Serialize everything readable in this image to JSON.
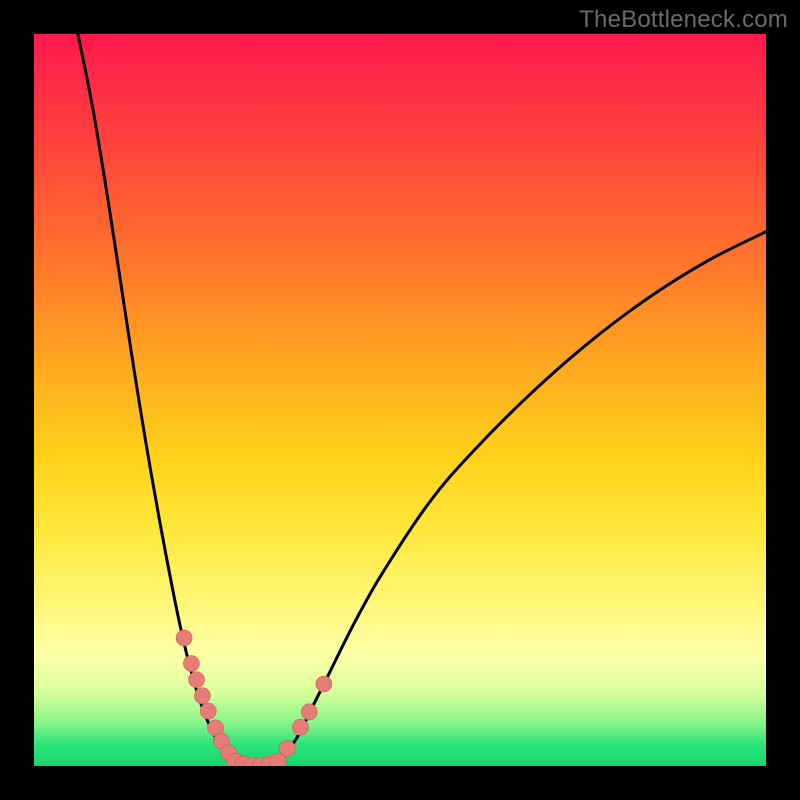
{
  "watermark": "TheBottleneck.com",
  "chart_data": {
    "type": "line",
    "title": "",
    "xlabel": "",
    "ylabel": "",
    "xlim": [
      0,
      100
    ],
    "ylim": [
      0,
      100
    ],
    "series": [
      {
        "name": "left-curve",
        "x": [
          6,
          8,
          10,
          12,
          14,
          16,
          18,
          20,
          22,
          24,
          26,
          27,
          28
        ],
        "values": [
          100,
          90,
          78,
          65,
          52,
          40,
          29,
          19,
          11,
          5.5,
          2,
          0.8,
          0
        ]
      },
      {
        "name": "right-curve",
        "x": [
          33,
          34,
          36,
          38,
          40,
          44,
          48,
          54,
          60,
          68,
          76,
          84,
          92,
          100
        ],
        "values": [
          0,
          1.2,
          4,
          8,
          12,
          20,
          27,
          36,
          43,
          51,
          58,
          64,
          69,
          73
        ]
      },
      {
        "name": "valley-floor",
        "x": [
          28,
          29,
          30,
          31,
          32,
          33
        ],
        "values": [
          0,
          0,
          0,
          0,
          0,
          0
        ]
      }
    ],
    "markers": {
      "left_arm": {
        "name": "left-markers",
        "x": [
          20.5,
          21.5,
          22.2,
          23.0,
          23.8,
          24.8,
          25.6,
          26.6
        ],
        "values": [
          17.5,
          14.0,
          11.8,
          9.6,
          7.5,
          5.2,
          3.4,
          1.8
        ]
      },
      "valley": {
        "name": "valley-markers",
        "x": [
          27.5,
          28.6,
          29.8,
          31.0,
          32.2,
          33.3
        ],
        "values": [
          0.6,
          0.2,
          0.0,
          0.0,
          0.2,
          0.6
        ]
      },
      "right_arm": {
        "name": "right-markers",
        "x": [
          34.6,
          36.4,
          37.6,
          39.6
        ],
        "values": [
          2.4,
          5.3,
          7.4,
          11.2
        ]
      }
    },
    "colors": {
      "curve": "#000000",
      "marker_fill": "#e77b75",
      "marker_stroke": "#c9605a"
    }
  }
}
